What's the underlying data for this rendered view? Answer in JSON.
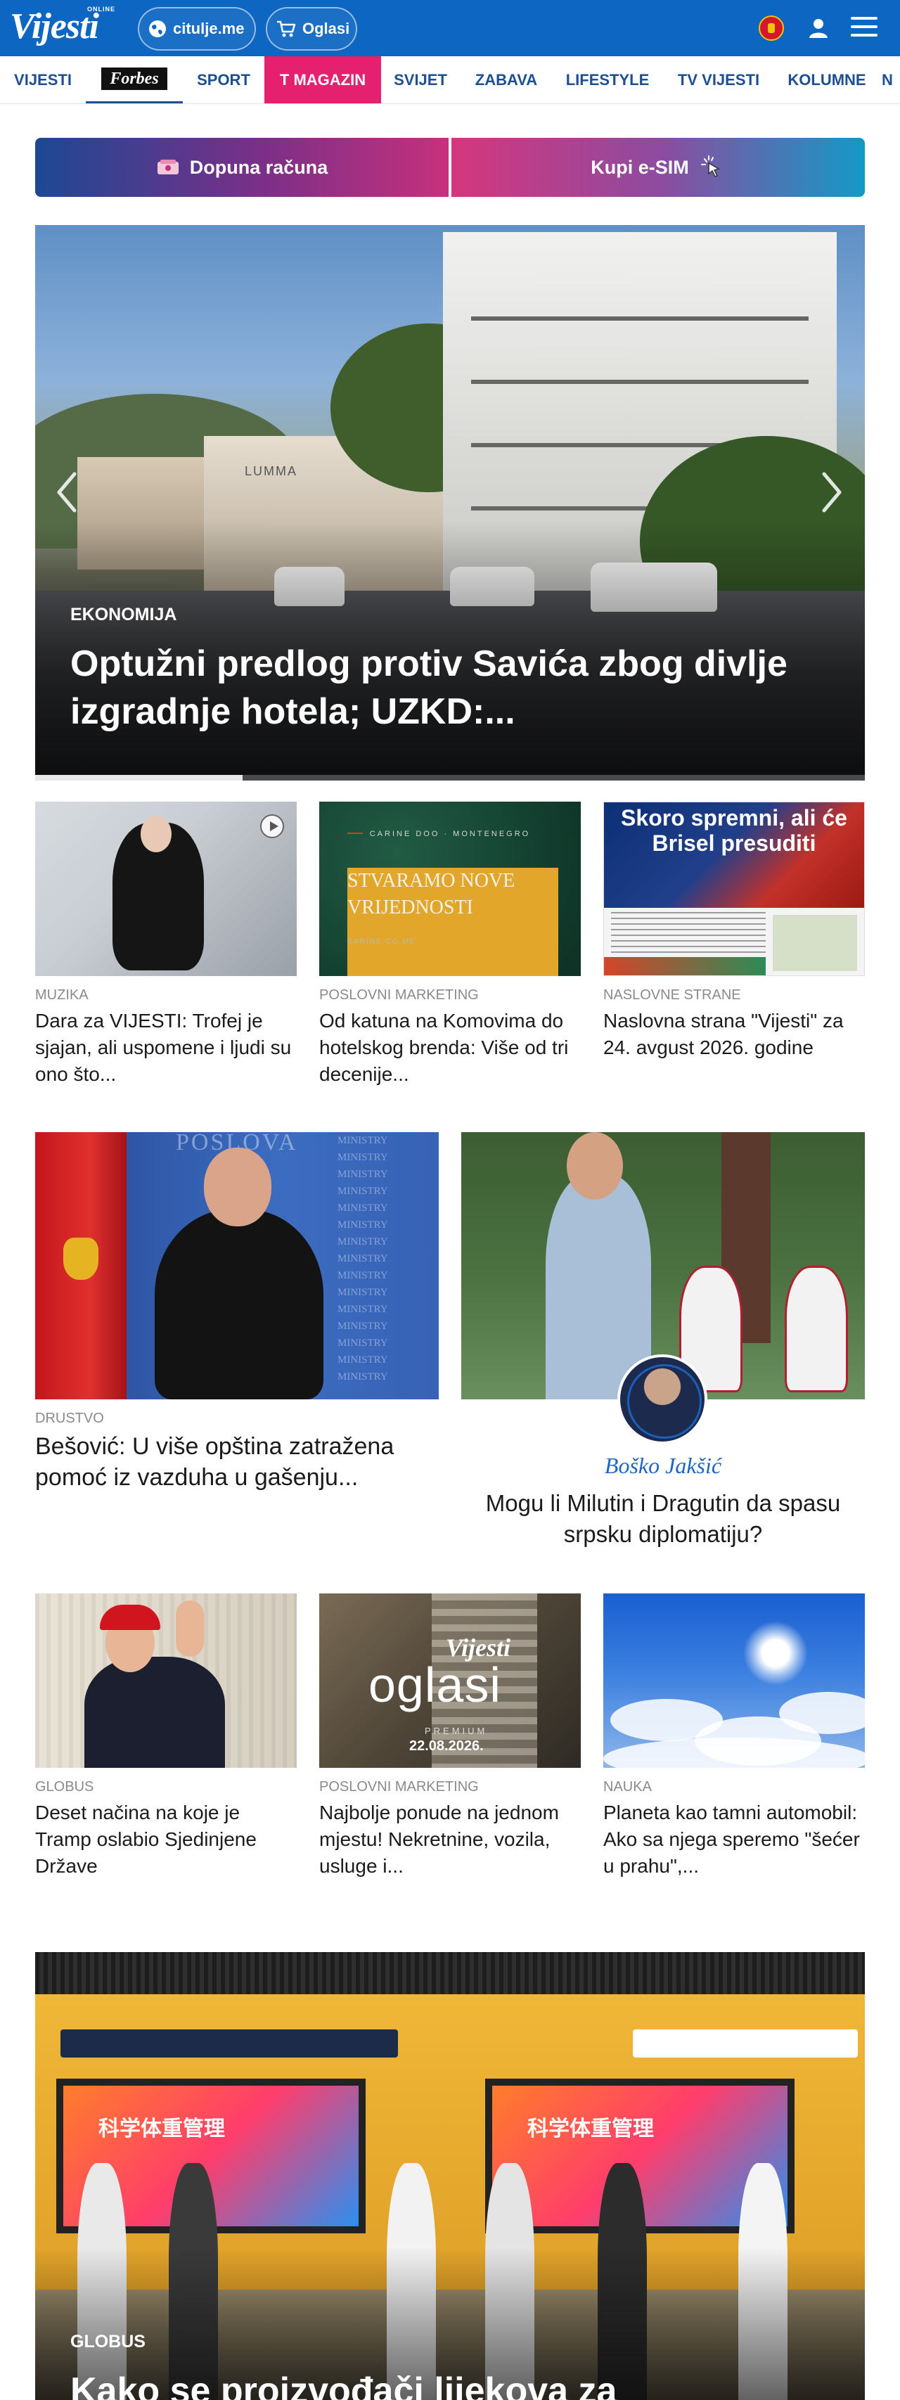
{
  "header": {
    "logo_text": "Vijesti",
    "logo_online": "ONLINE",
    "pill_1_label": "citulje.me",
    "pill_2_label": "Oglasi",
    "icons": [
      "globe-icon",
      "cart-icon",
      "montenegro-flag-icon",
      "user-icon",
      "menu-icon"
    ]
  },
  "nav": {
    "items": [
      "VIJESTI",
      "Forbes",
      "SPORT",
      "T MAGAZIN",
      "SVIJET",
      "ZABAVA",
      "LIFESTYLE",
      "TV VIJESTI",
      "KOLUMNE",
      "N"
    ],
    "highlight_color": "#e5206e",
    "link_color": "#1d4f91"
  },
  "promo": {
    "left_label": "Dopuna računa",
    "right_label": "Kupi e-SIM"
  },
  "hero": {
    "category": "EKONOMIJA",
    "title": "Optužni predlog protiv Savića zbog divlje izgradnje hotela; UZKD:...",
    "sign_text": "LUMMA",
    "slide_progress": 0.25
  },
  "row1": [
    {
      "category": "MUZIKA",
      "title": "Dara za VIJESTI: Trofej je sjajan, ali uspomene i ljudi su ono što..."
    },
    {
      "category": "POSLOVNI MARKETING",
      "title": "Od katuna na Komovima do hotelskog brenda: Više od tri decenije...",
      "image_top": "CARINE DOO · MONTENEGRO",
      "image_main": "STVARAMO NOVE VRIJEDNOSTI",
      "image_bottom": "CARINE.CO.ME"
    },
    {
      "category": "NASLOVNE STRANE",
      "title": "Naslovna strana \"Vijesti\" za 24. avgust 2026. godine",
      "image_headline": "Skoro spremni, ali će Brisel presuditi"
    }
  ],
  "row2": {
    "left": {
      "category": "DRUSTVO",
      "title": "Bešović: U više opština zatražena pomoć iz vazduha u gašenju...",
      "backdrop_text": "POSLOVA",
      "backdrop_word": "MINISTRY"
    },
    "right": {
      "author": "Boško Jakšić",
      "title": "Mogu li Milutin i Dragutin da spasu srpsku diplomatiju?"
    }
  },
  "row3": [
    {
      "category": "GLOBUS",
      "title": "Deset načina na koje je Tramp oslabio Sjedinjene Države"
    },
    {
      "category": "POSLOVNI MARKETING",
      "title": "Najbolje ponude na jednom mjestu! Nekretnine, vozila, usluge i...",
      "image_logo": "Vijesti",
      "image_word": "oglasi",
      "image_premium": "PREMIUM",
      "image_date": "22.08.2026."
    },
    {
      "category": "NAUKA",
      "title": "Planeta kao tamni automobil: Ako sa njega speremo \"šećer u prahu\",..."
    }
  ],
  "bottom_story": {
    "category": "GLOBUS",
    "title": "Kako se proizvođači lijekova za"
  }
}
